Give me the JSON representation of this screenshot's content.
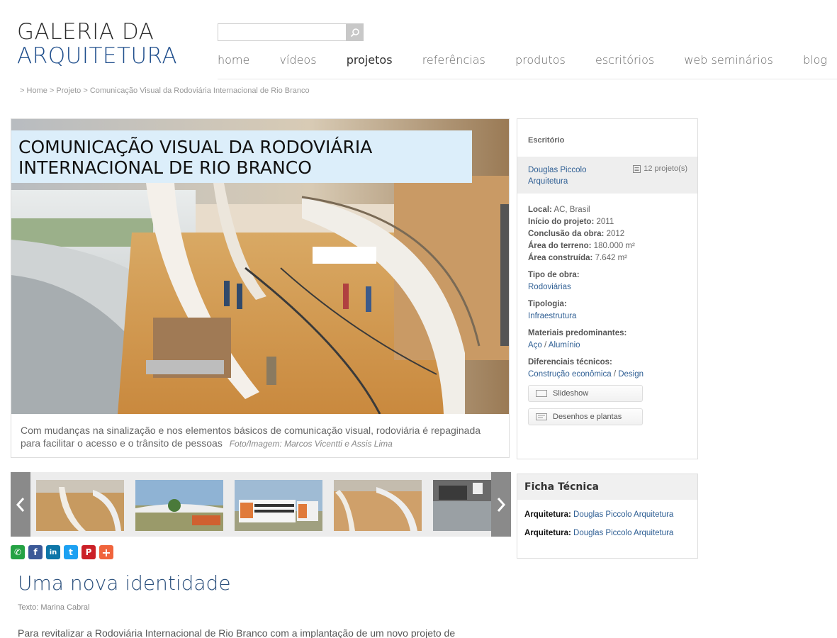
{
  "site": {
    "logo_line1": "GALERIA DA",
    "logo_line2": "ARQUITETURA"
  },
  "search": {
    "placeholder": "",
    "button_icon": "search-icon"
  },
  "nav": [
    {
      "label": "home",
      "active": false
    },
    {
      "label": "vídeos",
      "active": false
    },
    {
      "label": "projetos",
      "active": true
    },
    {
      "label": "referências",
      "active": false
    },
    {
      "label": "produtos",
      "active": false
    },
    {
      "label": "escritórios",
      "active": false
    },
    {
      "label": "web seminários",
      "active": false
    },
    {
      "label": "blog",
      "active": false
    }
  ],
  "breadcrumb": {
    "sep": ">",
    "home": "Home",
    "projeto": "Projeto",
    "current": "Comunicação Visual da Rodoviária Internacional de Rio Branco"
  },
  "hero": {
    "title": "COMUNICAÇÃO VISUAL DA RODOVIÁRIA INTERNACIONAL DE RIO BRANCO",
    "caption": "Com mudanças na sinalização e nos elementos básicos de comunicação visual, rodoviária é repaginada para facilitar o acesso e o trânsito de pessoas",
    "credit": "Foto/Imagem:  Marcos Vicentti e Assis Lima"
  },
  "sidebar": {
    "office_label": "Escritório",
    "office_name": "Douglas Piccolo Arquitetura",
    "projects_count": "12 projeto(s)",
    "local_label": "Local:",
    "local_value": "AC, Brasil",
    "inicio_label": "Início do projeto:",
    "inicio_value": "2011",
    "conclusao_label": "Conclusão da obra:",
    "conclusao_value": "2012",
    "terreno_label": "Área do terreno:",
    "terreno_value": "180.000 m²",
    "construida_label": "Área construída:",
    "construida_value": "7.642 m²",
    "tipo_label": "Tipo de obra:",
    "tipo_value": "Rodoviárias",
    "tipologia_label": "Tipologia:",
    "tipologia_value": "Infraestrutura",
    "materiais_label": "Materiais predominantes:",
    "material_1": "Aço",
    "material_sep": "/",
    "material_2": "Alumínio",
    "diferenciais_label": "Diferenciais técnicos:",
    "diferencial_1": "Construção econômica",
    "diferencial_sep": "/",
    "diferencial_2": "Design",
    "slideshow_label": "Slideshow",
    "desenhos_label": "Desenhos e plantas"
  },
  "ficha": {
    "title": "Ficha Técnica",
    "rows": [
      {
        "label": "Arquitetura:",
        "value": "Douglas Piccolo Arquitetura"
      },
      {
        "label": "Arquitetura:",
        "value": "Douglas Piccolo Arquitetura"
      }
    ]
  },
  "gallery": {
    "prev_icon": "chevron-left-icon",
    "next_icon": "chevron-right-icon",
    "thumb_count": 5
  },
  "social": [
    {
      "name": "whatsapp-icon",
      "glyph": "✆",
      "color": "#25a244"
    },
    {
      "name": "facebook-icon",
      "glyph": "f",
      "color": "#3b5998"
    },
    {
      "name": "linkedin-icon",
      "glyph": "in",
      "color": "#0e76a8"
    },
    {
      "name": "twitter-icon",
      "glyph": "t",
      "color": "#1da1f2"
    },
    {
      "name": "pinterest-icon",
      "glyph": "P",
      "color": "#cb2027"
    },
    {
      "name": "more-share-icon",
      "glyph": "+",
      "color": "#f0643c"
    }
  ],
  "article": {
    "heading": "Uma nova identidade",
    "author": "Texto: Marina Cabral",
    "first_line": "Para revitalizar a Rodoviária Internacional de Rio Branco com a implantação de um novo projeto de"
  }
}
